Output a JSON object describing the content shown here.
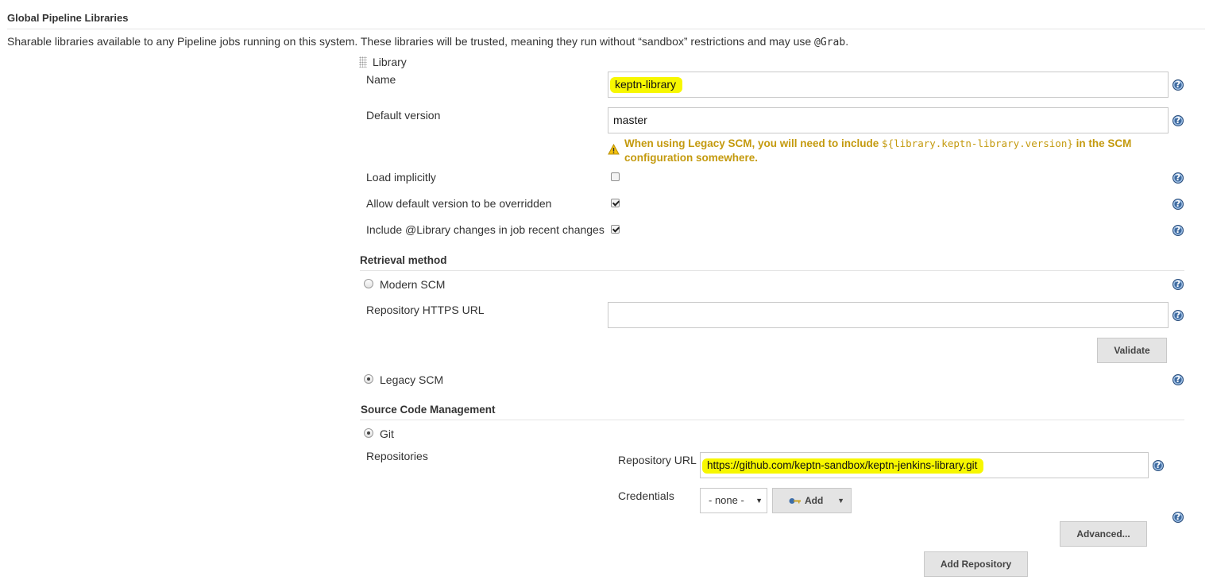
{
  "section": {
    "title": "Global Pipeline Libraries",
    "description_prefix": "Sharable libraries available to any Pipeline jobs running on this system. These libraries will be trusted, meaning they run without “sandbox” restrictions and may use ",
    "description_code": "@Grab",
    "description_suffix": "."
  },
  "library": {
    "header": "Library",
    "name_label": "Name",
    "name_value": "keptn-library",
    "default_version_label": "Default version",
    "default_version_value": "master",
    "warning_prefix": "When using Legacy SCM, you will need to include ",
    "warning_code": "${library.keptn-library.version}",
    "warning_suffix_line1": " in the SCM",
    "warning_line2": "configuration somewhere.",
    "load_implicitly_label": "Load implicitly",
    "load_implicitly_checked": false,
    "allow_override_label": "Allow default version to be overridden",
    "allow_override_checked": true,
    "include_changes_label": "Include @Library changes in job recent changes",
    "include_changes_checked": true
  },
  "retrieval": {
    "title": "Retrieval method",
    "modern_scm_label": "Modern SCM",
    "modern_scm_selected": false,
    "repo_https_url_label": "Repository HTTPS URL",
    "repo_https_url_value": "",
    "validate_label": "Validate",
    "legacy_scm_label": "Legacy SCM",
    "legacy_scm_selected": true
  },
  "scm": {
    "title": "Source Code Management",
    "git_label": "Git",
    "git_selected": true,
    "repositories_label": "Repositories",
    "repository_url_label": "Repository URL",
    "repository_url_value": "https://github.com/keptn-sandbox/keptn-jenkins-library.git",
    "credentials_label": "Credentials",
    "credentials_value": "- none -",
    "add_label": "Add",
    "advanced_label": "Advanced...",
    "add_repository_label": "Add Repository"
  },
  "colors": {
    "highlight": "#f7f700",
    "warning": "#c49a0e",
    "help_icon": "#3f6ba0"
  }
}
